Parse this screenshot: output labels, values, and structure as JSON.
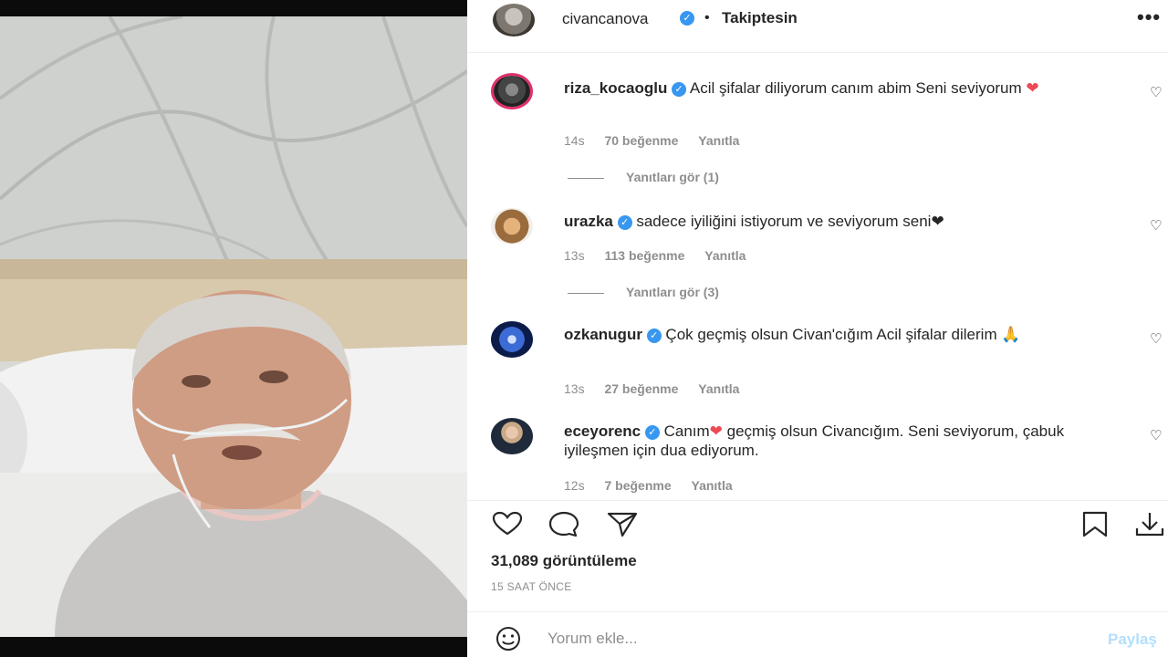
{
  "post": {
    "username": "civancanova",
    "separator": "•",
    "follow_status": "Takiptesin",
    "more": "•••"
  },
  "comments": [
    {
      "username": "riza_kocaoglu",
      "text": "Acil şifalar diliyorum canım abim Seni seviyorum",
      "emoji": "❤",
      "time": "14s",
      "likes": "70 beğenme",
      "reply": "Yanıtla",
      "view_replies": "Yanıtları gör (1)"
    },
    {
      "username": "urazka",
      "text": "sadece iyiliğini istiyorum ve seviyorum seni",
      "emoji": "❤",
      "time": "13s",
      "likes": "113 beğenme",
      "reply": "Yanıtla",
      "view_replies": "Yanıtları gör (3)"
    },
    {
      "username": "ozkanugur",
      "text": "Çok geçmiş olsun Civan'cığım Acil şifalar dilerim",
      "emoji": "🙏",
      "time": "13s",
      "likes": "27 beğenme",
      "reply": "Yanıtla"
    },
    {
      "username": "eceyorenc",
      "text_before": "Canım",
      "emoji": "❤",
      "text_after": " geçmiş olsun Civancığım. Seni seviyorum, çabuk iyileşmen için dua ediyorum.",
      "time": "12s",
      "likes": "7 beğenme",
      "reply": "Yanıtla"
    }
  ],
  "stats": {
    "views": "31,089 görüntüleme",
    "time_ago": "15 SAAT ÖNCE"
  },
  "composer": {
    "placeholder": "Yorum ekle...",
    "share": "Paylaş"
  },
  "colors": {
    "verified": "#3897f0",
    "heart": "#ed4956",
    "meta": "#8e8e8e",
    "share_disabled": "#b2dffc"
  }
}
